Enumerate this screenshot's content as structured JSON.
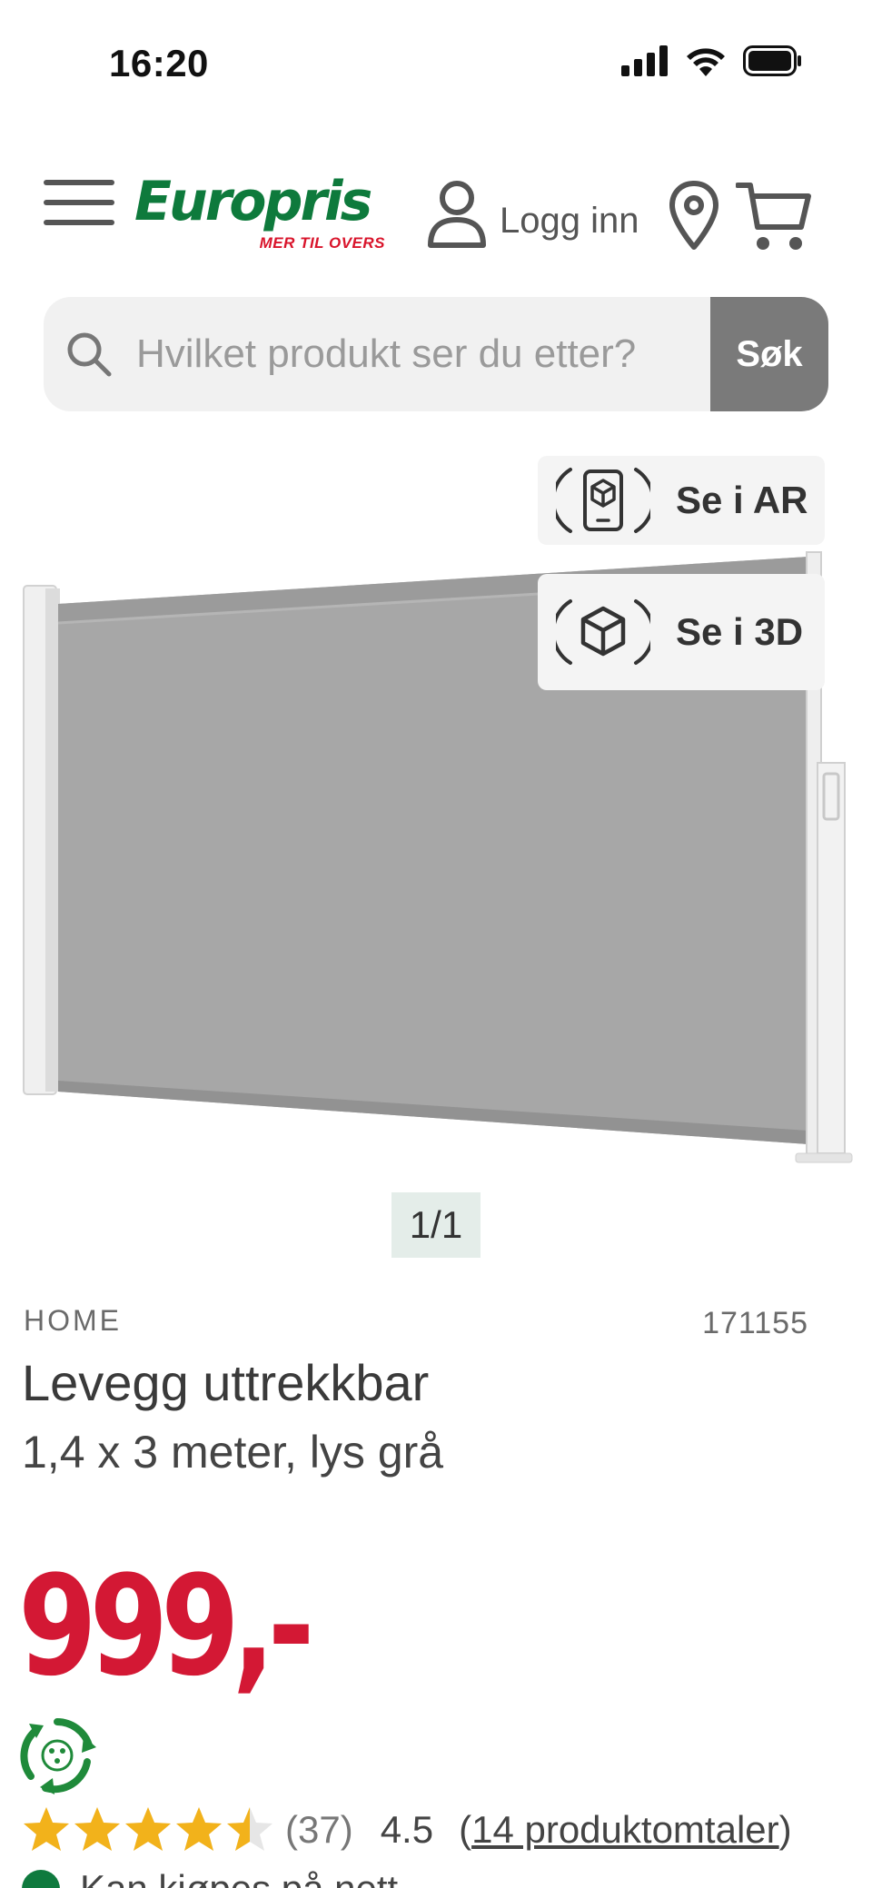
{
  "status": {
    "time": "16:20"
  },
  "header": {
    "logo_text": "Europris",
    "logo_tagline": "MER TIL OVERS",
    "login_label": "Logg inn"
  },
  "search": {
    "placeholder": "Hvilket produkt ser du etter?",
    "button_label": "Søk"
  },
  "media": {
    "ar_label": "Se i AR",
    "threed_label": "Se i 3D",
    "pager": "1/1"
  },
  "product": {
    "brand": "HOME",
    "sku": "171155",
    "title": "Levegg uttrekkbar",
    "subtitle": "1,4 x 3 meter, lys grå",
    "price": "999,-",
    "rating_count": "(37)",
    "rating_value": "4.5",
    "rating_stars": 4.5,
    "reviews_open": "(",
    "reviews_link": "14 produktomtaler",
    "reviews_close": ")",
    "stock_text": "Kan kjøpes på nett"
  },
  "colors": {
    "brand_green": "#0e7a3c",
    "price_red": "#d31834",
    "star_gold": "#f2b21b"
  }
}
